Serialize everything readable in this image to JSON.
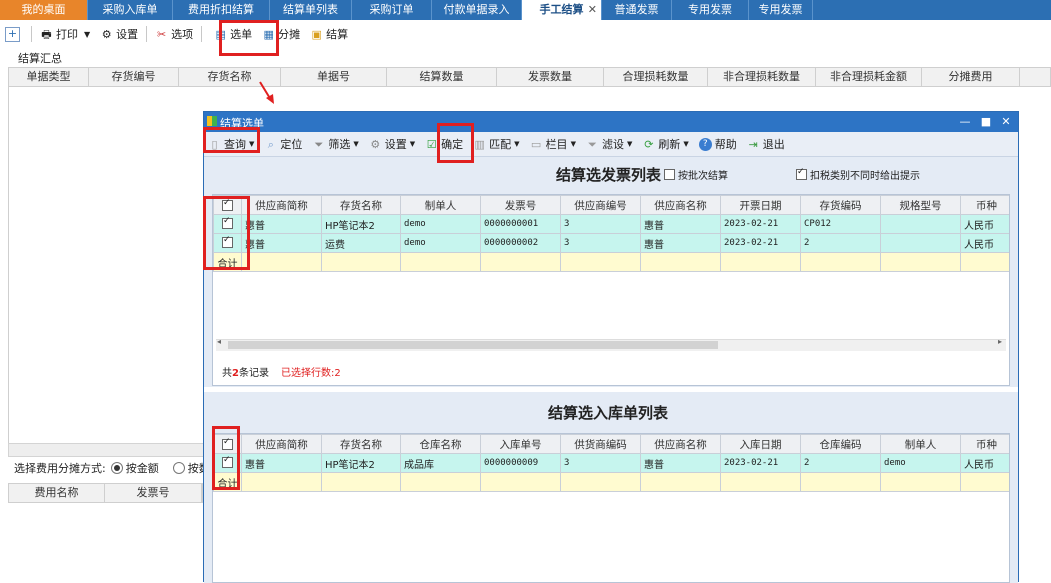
{
  "tabs": [
    {
      "label": "我的桌面",
      "w": 88,
      "kind": "home"
    },
    {
      "label": "采购入库单",
      "w": 85
    },
    {
      "label": "费用折扣结算",
      "w": 97
    },
    {
      "label": "结算单列表",
      "w": 82
    },
    {
      "label": "采购订单",
      "w": 80
    },
    {
      "label": "付款单据录入",
      "w": 90
    },
    {
      "label": "手工结算",
      "w": 80,
      "kind": "active"
    },
    {
      "label": "普通发票",
      "w": 70
    },
    {
      "label": "专用发票",
      "w": 77
    },
    {
      "label": "专用发票",
      "w": 64
    }
  ],
  "tab_close": "✕",
  "toolbar": {
    "print": "打印",
    "settings": "设置",
    "options": "选项",
    "select_doc": "选单",
    "allocate": "分摊",
    "settle": "结算"
  },
  "summary_title": "结算汇总",
  "main_headers": [
    "单据类型",
    "存货编号",
    "存货名称",
    "单据号",
    "结算数量",
    "发票数量",
    "合理损耗数量",
    "非合理损耗数量",
    "非合理损耗金额",
    "分摊费用"
  ],
  "alloc": {
    "label": "选择费用分摊方式:",
    "opt1": "按金额",
    "opt2": "按数量"
  },
  "fee_headers": [
    "费用名称",
    "发票号"
  ],
  "dialog": {
    "title": "结算选单",
    "toolbar": {
      "query": "查询",
      "locate": "定位",
      "filter": "筛选",
      "settings": "设置",
      "confirm": "确定",
      "match": "匹配",
      "columns": "栏目",
      "filter2": "滤设",
      "refresh": "刷新",
      "help": "帮助",
      "exit": "退出"
    },
    "invoice_title": "结算选发票列表",
    "batch_label": "按批次结算",
    "tax_label": "扣税类别不同时给出提示",
    "invoice_headers": [
      "",
      "供应商简称",
      "存货名称",
      "制单人",
      "发票号",
      "供应商编号",
      "供应商名称",
      "开票日期",
      "存货编码",
      "规格型号",
      "币种"
    ],
    "invoice_rows": [
      [
        "惠普",
        "HP笔记本2",
        "demo",
        "0000000001",
        "3",
        "惠普",
        "2023-02-21",
        "CP012",
        "",
        "人民币"
      ],
      [
        "惠普",
        "运费",
        "demo",
        "0000000002",
        "3",
        "惠普",
        "2023-02-21",
        "2",
        "",
        "人民币"
      ]
    ],
    "total_label": "合计",
    "record_pre": "共",
    "record_count": "2",
    "record_post": "条记录",
    "selected_text": "已选择行数:2",
    "receipt_title": "结算选入库单列表",
    "receipt_headers": [
      "",
      "供应商简称",
      "存货名称",
      "仓库名称",
      "入库单号",
      "供货商编码",
      "供应商名称",
      "入库日期",
      "仓库编码",
      "制单人",
      "币种"
    ],
    "receipt_rows": [
      [
        "惠普",
        "HP笔记本2",
        "成品库",
        "0000000009",
        "3",
        "惠普",
        "2023-02-21",
        "2",
        "demo",
        "人民币"
      ]
    ]
  }
}
